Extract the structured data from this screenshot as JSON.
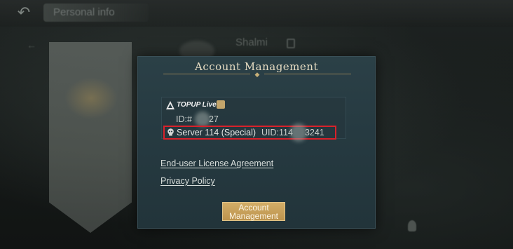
{
  "background": {
    "page_title": "Personal info",
    "player_name": "Shalmi"
  },
  "dialog": {
    "title": "Account Management",
    "account": {
      "platform_label": "TOPUP Live",
      "id_prefix": "ID:#",
      "id_suffix": "27",
      "server_name": "Server 114 (Special)",
      "uid_prefix": "UID:114",
      "uid_suffix": "3241"
    },
    "links": {
      "eula": "End-user License Agreement",
      "privacy": "Privacy Policy"
    },
    "account_management_button": {
      "line1": "Account",
      "line2": "Management"
    }
  },
  "colors": {
    "dialog_bg": "#263a41",
    "title_text": "#e6dcc2",
    "highlight_border": "#d9212a",
    "button_gold": "#c9a45e"
  },
  "icons": {
    "back": "back-arrow-icon",
    "topup": "topup-logo-icon",
    "server": "skull-icon"
  }
}
